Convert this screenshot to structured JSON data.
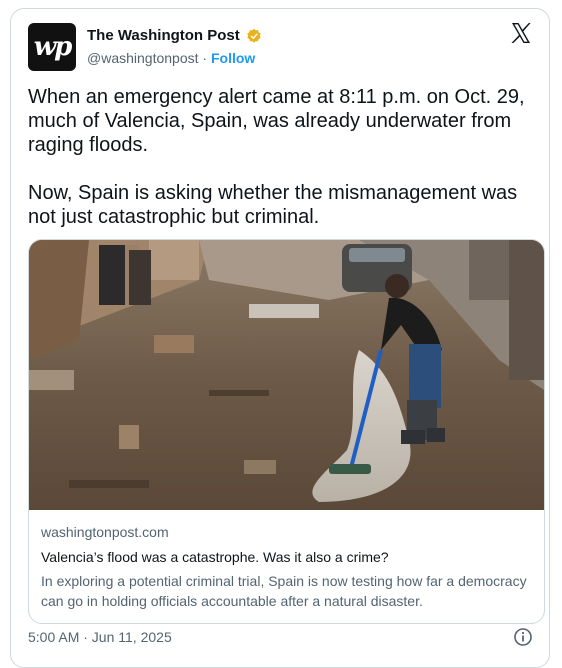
{
  "author": {
    "avatar_text": "wp",
    "name": "The Washington Post",
    "handle": "@washingtonpost",
    "separator": "·",
    "follow_label": "Follow",
    "verified_color": "#e8b21a",
    "follow_color": "#1d9bf0"
  },
  "tweet": {
    "text": "When an emergency alert came at 8:11 p.m. on Oct. 29, much of Valencia, Spain, was already underwater from raging floods.\n\nNow, Spain is asking whether the mismanagement was not just catastrophic but criminal."
  },
  "link_card": {
    "domain": "washingtonpost.com",
    "headline": "Valencia’s flood was a catastrophe. Was it also a crime?",
    "description": "In exploring a potential criminal trial, Spain is now testing how far a democracy can go in holding officials accountable after a natural disaster."
  },
  "meta": {
    "timestamp": "5:00 AM · Jun 11, 2025"
  },
  "icons": {
    "platform": "x-logo-icon",
    "verified": "verified-badge-icon",
    "info": "info-icon"
  }
}
